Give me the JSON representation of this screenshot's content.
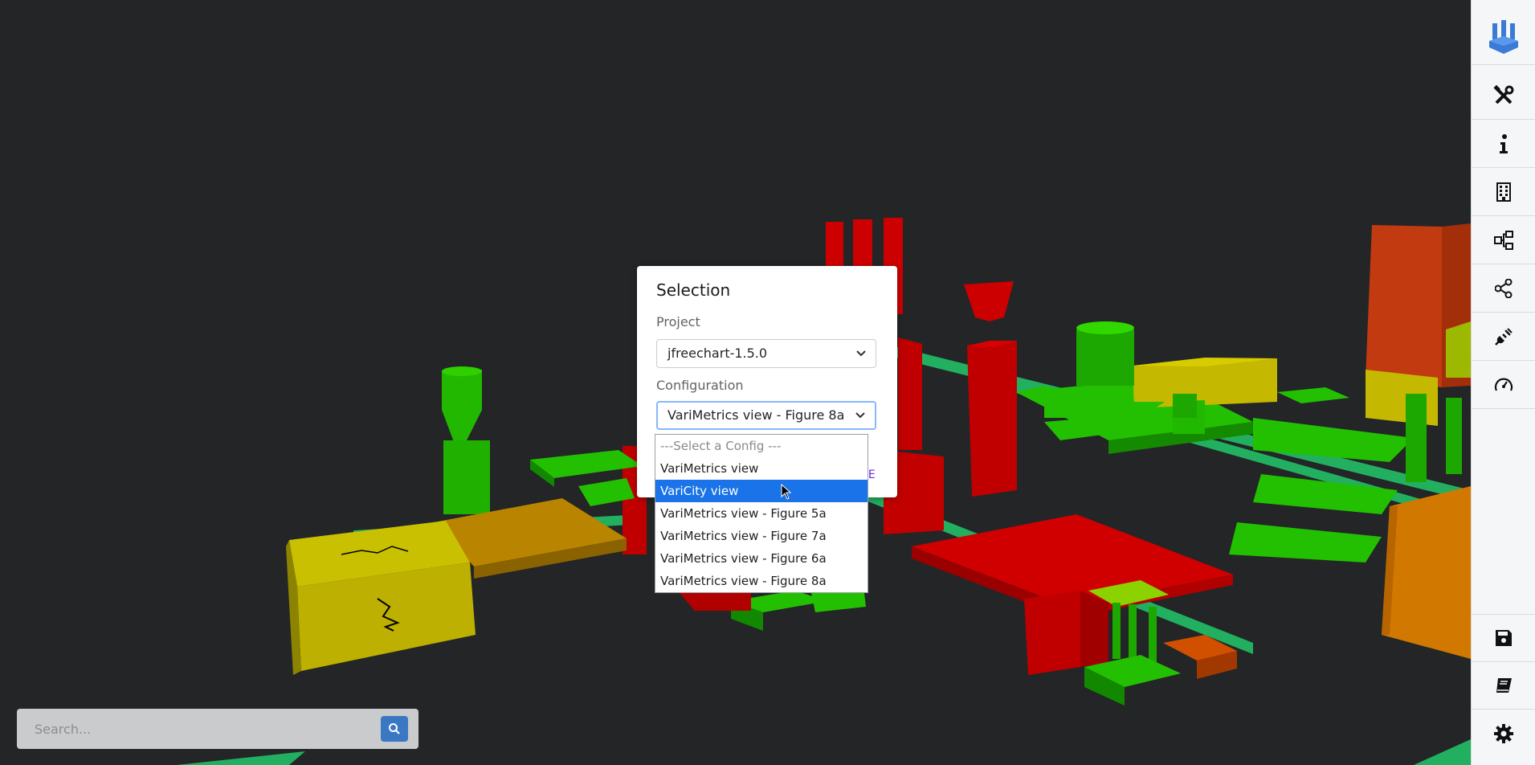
{
  "modal": {
    "title": "Selection",
    "project_label": "Project",
    "project_value": "jfreechart-1.5.0",
    "config_label": "Configuration",
    "config_value": "VariMetrics view - Figure 8a",
    "close_label": "SE"
  },
  "dropdown": {
    "options": [
      "---Select a Config ---",
      "VariMetrics view",
      "VariCity view",
      "VariMetrics view - Figure 5a",
      "VariMetrics view - Figure 7a",
      "VariMetrics view - Figure 6a",
      "VariMetrics view - Figure 8a"
    ],
    "highlighted": "VariCity view"
  },
  "search": {
    "placeholder": "Search..."
  },
  "sidebar": {
    "top_icons": [
      "app-logo-icon",
      "tools-icon",
      "info-icon",
      "building-icon",
      "hierarchy-icon",
      "share-icon",
      "plug-icon",
      "gauge-icon"
    ],
    "bottom_icons": [
      "save-icon",
      "book-icon",
      "gear-icon"
    ]
  },
  "colors": {
    "background": "#232527",
    "accent": "#1a73e8",
    "search_button": "#3a78c3",
    "logo": "#3a7bd5",
    "city_red": "#d40000",
    "city_green": "#1fb800",
    "city_yellow": "#cfc000",
    "city_orange": "#d87000"
  }
}
